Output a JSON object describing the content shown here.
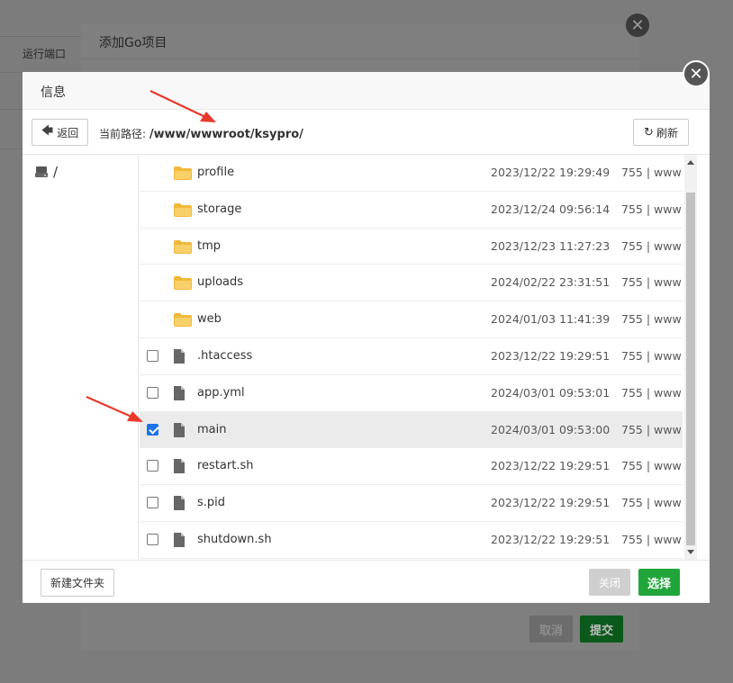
{
  "background": {
    "column_label": "运行端口"
  },
  "under_dialog": {
    "title": "添加Go项目",
    "cancel_label": "取消",
    "submit_label": "提交"
  },
  "dialog": {
    "title": "信息",
    "back_label": "返回",
    "path_label": "当前路径:",
    "current_path": "/www/wwwroot/ksypro/",
    "refresh_label": "刷新",
    "root_label": "/",
    "new_folder_label": "新建文件夹",
    "close_label": "关闭",
    "choose_label": "选择"
  },
  "files": [
    {
      "name": "profile",
      "type": "folder",
      "date": "2023/12/22 19:29:49",
      "perm": "755 | www",
      "checked": false
    },
    {
      "name": "storage",
      "type": "folder",
      "date": "2023/12/24 09:56:14",
      "perm": "755 | www",
      "checked": false
    },
    {
      "name": "tmp",
      "type": "folder",
      "date": "2023/12/23 11:27:23",
      "perm": "755 | www",
      "checked": false
    },
    {
      "name": "uploads",
      "type": "folder",
      "date": "2024/02/22 23:31:51",
      "perm": "755 | www",
      "checked": false
    },
    {
      "name": "web",
      "type": "folder",
      "date": "2024/01/03 11:41:39",
      "perm": "755 | www",
      "checked": false
    },
    {
      "name": ".htaccess",
      "type": "file",
      "date": "2023/12/22 19:29:51",
      "perm": "755 | www",
      "checked": false
    },
    {
      "name": "app.yml",
      "type": "file",
      "date": "2024/03/01 09:53:01",
      "perm": "755 | www",
      "checked": false
    },
    {
      "name": "main",
      "type": "file",
      "date": "2024/03/01 09:53:00",
      "perm": "755 | www",
      "checked": true
    },
    {
      "name": "restart.sh",
      "type": "file",
      "date": "2023/12/22 19:29:51",
      "perm": "755 | www",
      "checked": false
    },
    {
      "name": "s.pid",
      "type": "file",
      "date": "2023/12/22 19:29:51",
      "perm": "755 | www",
      "checked": false
    },
    {
      "name": "shutdown.sh",
      "type": "file",
      "date": "2023/12/22 19:29:51",
      "perm": "755 | www",
      "checked": false
    }
  ],
  "colors": {
    "accent_green": "#20a53a",
    "annotation_red": "#e8392b",
    "folder_yellow": "#f6c453"
  },
  "icons": {
    "folder": "folder-icon",
    "file": "file-icon",
    "drive": "drive-icon",
    "back": "back-arrow-icon",
    "refresh": "refresh-icon",
    "close": "close-icon"
  }
}
